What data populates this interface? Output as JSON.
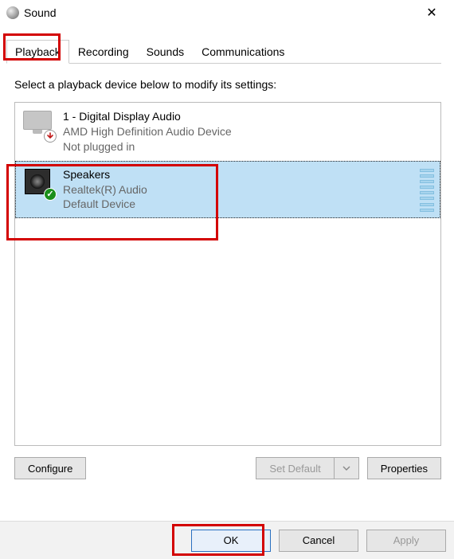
{
  "window": {
    "title": "Sound"
  },
  "tabs": {
    "playback": "Playback",
    "recording": "Recording",
    "sounds": "Sounds",
    "communications": "Communications"
  },
  "instruction": "Select a playback device below to modify its settings:",
  "devices": {
    "dev0": {
      "name": "1 - Digital Display Audio",
      "driver": "AMD High Definition Audio Device",
      "status": "Not plugged in"
    },
    "dev1": {
      "name": "Speakers",
      "driver": "Realtek(R) Audio",
      "status": "Default Device"
    }
  },
  "buttons": {
    "configure": "Configure",
    "set_default": "Set Default",
    "properties": "Properties",
    "ok": "OK",
    "cancel": "Cancel",
    "apply": "Apply"
  }
}
